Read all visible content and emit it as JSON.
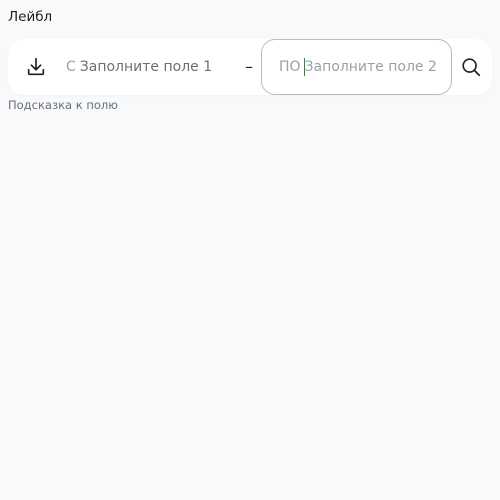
{
  "field": {
    "label": "Лейбл",
    "hint": "Подсказка к полю",
    "download_icon": "download-icon",
    "search_icon": "search-icon",
    "from": {
      "prefix": "С",
      "placeholder": "Заполните поле 1",
      "value": ""
    },
    "separator": "–",
    "to": {
      "prefix": "ПО",
      "placeholder": "Заполните поле 2",
      "value": ""
    }
  },
  "colors": {
    "caret": "#2a8a3a",
    "border_active": "#b9bcc2",
    "background": "#f8f9fb"
  }
}
